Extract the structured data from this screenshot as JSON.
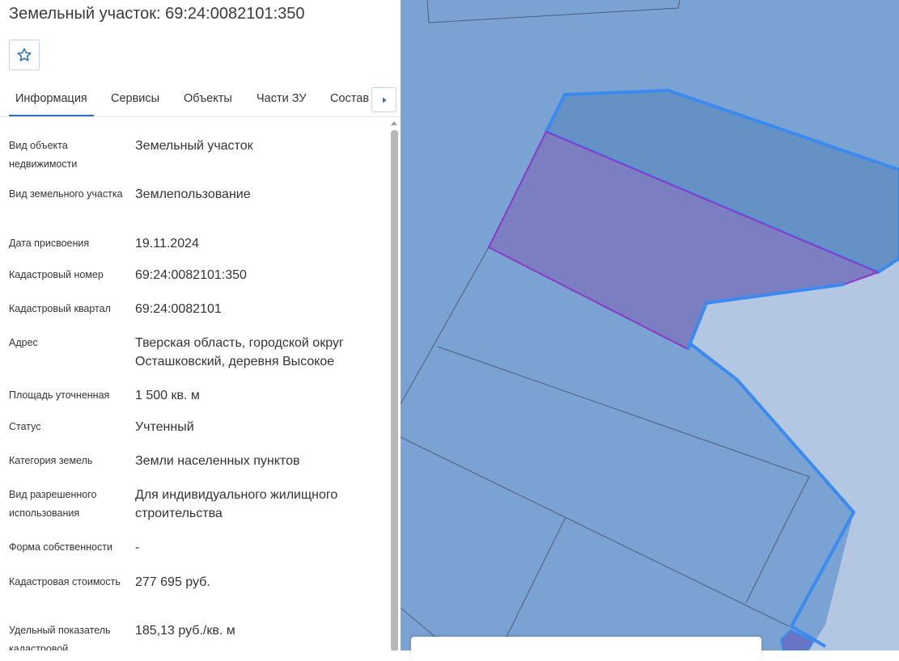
{
  "header": {
    "title": "Земельный участок: 69:24:0082101:350"
  },
  "tabs": [
    {
      "label": "Информация",
      "active": true
    },
    {
      "label": "Сервисы"
    },
    {
      "label": "Объекты"
    },
    {
      "label": "Части ЗУ"
    },
    {
      "label": "Состав"
    }
  ],
  "info": [
    {
      "label": "Вид объекта недвижимости",
      "value": "Земельный участок"
    },
    {
      "label": "Вид земельного участка",
      "value": "Землепользование"
    },
    {
      "label": "Дата присвоения",
      "value": "19.11.2024"
    },
    {
      "label": "Кадастровый номер",
      "value": "69:24:0082101:350"
    },
    {
      "label": "Кадастровый квартал",
      "value": "69:24:0082101"
    },
    {
      "label": "Адрес",
      "value": "Тверская область, городской округ Осташковский, деревня Высокое"
    },
    {
      "label": "Площадь уточненная",
      "value": "1 500 кв. м"
    },
    {
      "label": "Статус",
      "value": "Учтенный"
    },
    {
      "label": "Категория земель",
      "value": "Земли населенных пунктов"
    },
    {
      "label": "Вид разрешенного использования",
      "value": "Для индивидуального жилищного строительства"
    },
    {
      "label": "Форма собственности",
      "value": "-"
    },
    {
      "label": "Кадастровая стоимость",
      "value": "277 695 руб."
    },
    {
      "label": "Удельный показатель кадастровой",
      "value": "185,13 руб./кв. м"
    }
  ],
  "icons": {
    "favorite": "star-outline-icon",
    "tabs_next": "chevron-right-icon",
    "scroll_up": "scroll-up-arrow-icon"
  },
  "colors": {
    "accent": "#2f6fbb",
    "map_background": "#7aa2d3",
    "selected_parcel": "#7b7fc1",
    "selected_border": "#8a3ac9",
    "highlight_border": "#3b8af0",
    "light_area": "#b3c7e3"
  }
}
